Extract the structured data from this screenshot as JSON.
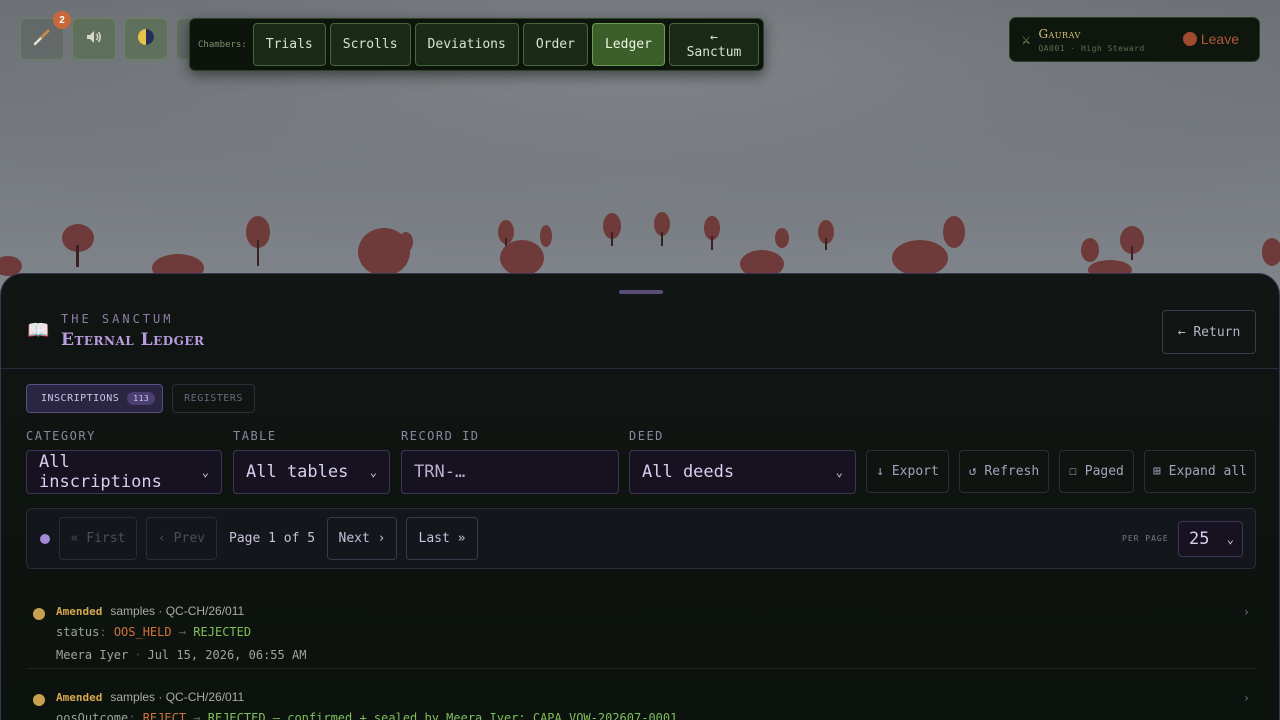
{
  "toolbar": {
    "notifications_count": "2",
    "icons": [
      "brush-icon",
      "speaker-icon",
      "moon-icon"
    ]
  },
  "chambers": {
    "label": "Chambers:",
    "items": [
      {
        "label": "Trials"
      },
      {
        "label": "Scrolls"
      },
      {
        "label": "Deviations"
      },
      {
        "label": "Order"
      },
      {
        "label": "Ledger",
        "active": true
      },
      {
        "label": "← Sanctum"
      }
    ]
  },
  "user": {
    "name": "Gaurav",
    "role": "QA001 · High Steward",
    "leave_label": "Leave"
  },
  "panel": {
    "kicker": "THE SANCTUM",
    "title": "Eternal Ledger",
    "return_label": "← Return"
  },
  "tabs": {
    "inscriptions_label": "INSCRIPTIONS",
    "inscriptions_count": "113",
    "registers_label": "REGISTERS"
  },
  "filters": {
    "category_label": "CATEGORY",
    "category_value": "All inscriptions",
    "table_label": "TABLE",
    "table_value": "All tables",
    "record_label": "RECORD ID",
    "record_placeholder": "TRN-…",
    "deed_label": "DEED",
    "deed_value": "All deeds",
    "export_label": "↓ Export",
    "refresh_label": "↺ Refresh",
    "paged_label": "☐ Paged",
    "expand_label": "⊞ Expand all"
  },
  "pager": {
    "first_label": "« First",
    "prev_label": "‹ Prev",
    "page_info": "Page 1 of 5",
    "next_label": "Next ›",
    "last_label": "Last »",
    "per_page_label": "PER PAGE",
    "per_page_value": "25"
  },
  "entries": [
    {
      "kind": "Amended",
      "ref": "samples · QC-CH/26/011",
      "field": "status",
      "old": "OOS_HELD",
      "new": "REJECTED",
      "note": "",
      "author": "Meera Iyer",
      "time": "Jul 15, 2026, 06:55 AM"
    },
    {
      "kind": "Amended",
      "ref": "samples · QC-CH/26/011",
      "field": "oosOutcome",
      "old": "REJECT",
      "new": "REJECTED",
      "note": " — confirmed + sealed by Meera Iyer; CAPA VOW-202607-0001",
      "author": "",
      "time": ""
    }
  ],
  "colors": {
    "accent_purple": "#b99ce0",
    "accent_green": "#3b5e2a",
    "amended": "#d6a84e",
    "old_value": "#d0743a",
    "new_value": "#7fbf5a"
  }
}
